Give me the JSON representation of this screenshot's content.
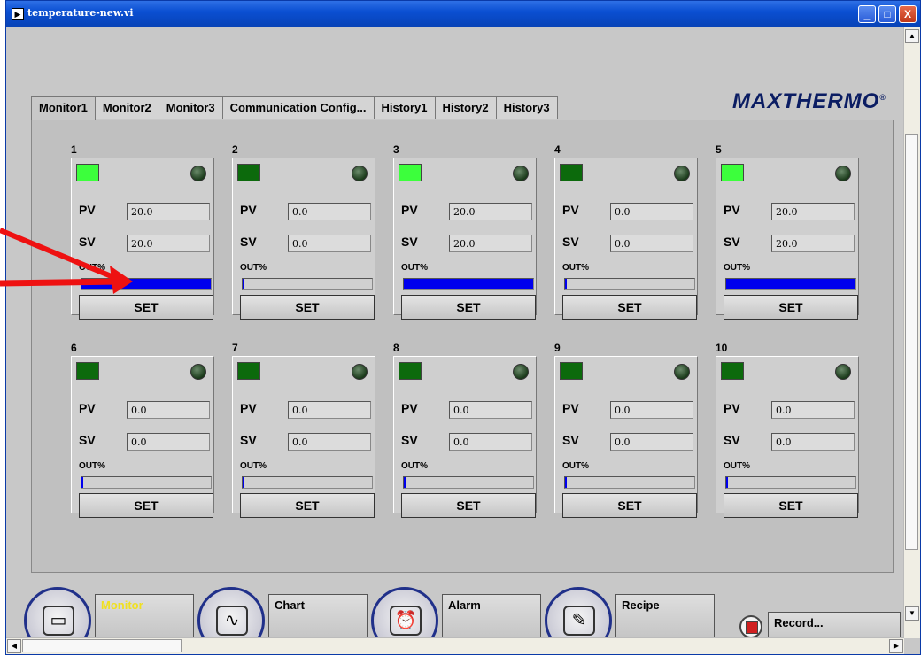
{
  "window": {
    "title": "temperature-new.vi",
    "minimize": "_",
    "maximize": "□",
    "close": "X"
  },
  "tabs": [
    "Monitor1",
    "Monitor2",
    "Monitor3",
    "Communication Config...",
    "History1",
    "History2",
    "History3"
  ],
  "active_tab": "Monitor1",
  "logo": {
    "text": "MAXTHERMO",
    "mark": "®"
  },
  "labels": {
    "pv": "PV",
    "sv": "SV",
    "out": "OUT%",
    "set": "SET"
  },
  "controllers": [
    {
      "num": "1",
      "status": "on",
      "pv": "20.0",
      "sv": "20.0",
      "out": 1.0
    },
    {
      "num": "2",
      "status": "off",
      "pv": "0.0",
      "sv": "0.0",
      "out": 0.0
    },
    {
      "num": "3",
      "status": "on",
      "pv": "20.0",
      "sv": "20.0",
      "out": 1.0
    },
    {
      "num": "4",
      "status": "off",
      "pv": "0.0",
      "sv": "0.0",
      "out": 0.0
    },
    {
      "num": "5",
      "status": "on",
      "pv": "20.0",
      "sv": "20.0",
      "out": 1.0
    },
    {
      "num": "6",
      "status": "off",
      "pv": "0.0",
      "sv": "0.0",
      "out": 0.0
    },
    {
      "num": "7",
      "status": "off",
      "pv": "0.0",
      "sv": "0.0",
      "out": 0.0
    },
    {
      "num": "8",
      "status": "off",
      "pv": "0.0",
      "sv": "0.0",
      "out": 0.0
    },
    {
      "num": "9",
      "status": "off",
      "pv": "0.0",
      "sv": "0.0",
      "out": 0.0
    },
    {
      "num": "10",
      "status": "off",
      "pv": "0.0",
      "sv": "0.0",
      "out": 0.0
    }
  ],
  "bottom_nav": [
    {
      "label": "Monitor",
      "color": "#f0e020",
      "icon": "monitor-icon"
    },
    {
      "label": "Chart",
      "color": "#000000",
      "icon": "chart-icon"
    },
    {
      "label": "Alarm",
      "color": "#000000",
      "icon": "alarm-icon"
    },
    {
      "label": "Recipe",
      "color": "#000000",
      "icon": "recipe-icon"
    }
  ],
  "record_button": "Record...",
  "colors": {
    "led_on": "#3cff3c",
    "led_off": "#0c6a0c",
    "bar_fill": "#0000ee",
    "arrow": "#ee1111"
  }
}
